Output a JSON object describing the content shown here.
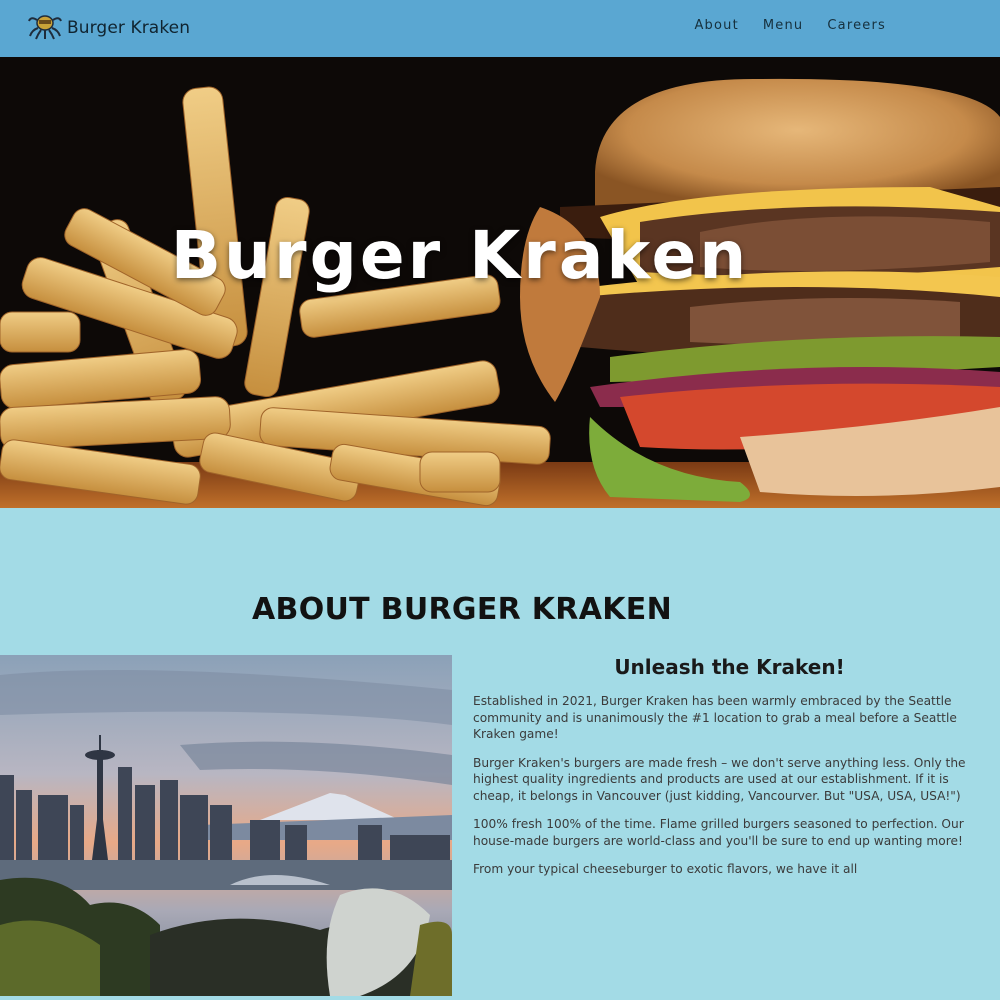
{
  "nav": {
    "brand": "Burger Kraken",
    "links": [
      "About",
      "Menu",
      "Careers"
    ]
  },
  "hero": {
    "title": "Burger Kraken"
  },
  "about": {
    "heading": "ABOUT BURGER KRAKEN",
    "subheading": "Unleash the Kraken!",
    "paragraphs": [
      "Established in 2021, Burger Kraken has been warmly embraced by the Seattle community and is unanimously the #1 location to grab a meal before a Seattle Kraken game!",
      "Burger Kraken's burgers are made fresh – we don't serve anything less. Only the highest quality ingredients and products are used at our establishment. If it is cheap, it belongs in Vancouver (just kidding, Vancourver. But \"USA, USA, USA!\")",
      "100% fresh 100% of the time. Flame grilled burgers seasoned to perfection. Our house-made burgers are world-class and you'll be sure to end up wanting more!",
      "From your typical cheeseburger to exotic flavors, we have it all"
    ]
  },
  "colors": {
    "navbar": "#5aa7d2",
    "page_background": "#a3dbe6"
  },
  "icons": {
    "brand_logo": "kraken-logo-icon"
  }
}
